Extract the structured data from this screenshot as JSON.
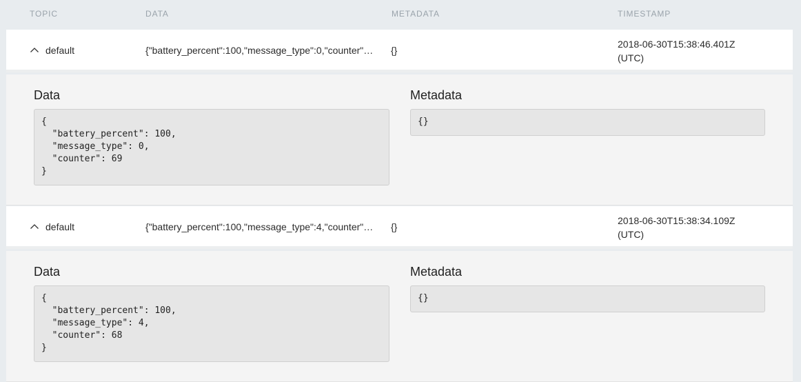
{
  "header": {
    "topic": "TOPIC",
    "data": "DATA",
    "metadata": "METADATA",
    "timestamp": "TIMESTAMP"
  },
  "rows": [
    {
      "topic": "default",
      "data_preview": "{\"battery_percent\":100,\"message_type\":0,\"counter\":69}",
      "metadata_preview": "{}",
      "timestamp_line1": "2018-06-30T15:38:46.401Z",
      "timestamp_line2": "(UTC)",
      "expanded": true,
      "detail": {
        "data_title": "Data",
        "data_json": "{\n  \"battery_percent\": 100,\n  \"message_type\": 0,\n  \"counter\": 69\n}",
        "metadata_title": "Metadata",
        "metadata_json": "{}"
      }
    },
    {
      "topic": "default",
      "data_preview": "{\"battery_percent\":100,\"message_type\":4,\"counter\":68}",
      "metadata_preview": "{}",
      "timestamp_line1": "2018-06-30T15:38:34.109Z",
      "timestamp_line2": "(UTC)",
      "expanded": true,
      "detail": {
        "data_title": "Data",
        "data_json": "{\n  \"battery_percent\": 100,\n  \"message_type\": 4,\n  \"counter\": 68\n}",
        "metadata_title": "Metadata",
        "metadata_json": "{}"
      }
    }
  ],
  "icons": {
    "toggle": "chevron-up-icon"
  },
  "colors": {
    "page_background": "#e8ecef",
    "row_background": "#ffffff",
    "detail_background": "#f4f4f4",
    "code_background": "#e6e6e6",
    "header_text": "#9aa3ab"
  }
}
